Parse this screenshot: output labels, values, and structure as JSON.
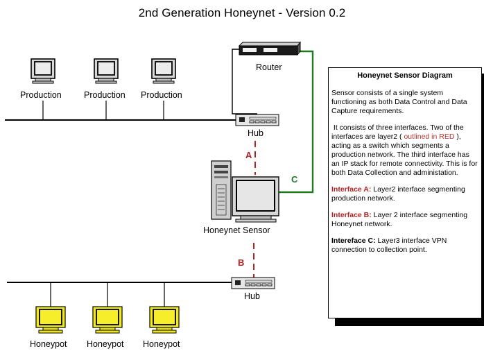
{
  "title": "2nd Generation Honeynet - Version 0.2",
  "colors": {
    "link_c": "#1e7b1e",
    "link_ab": "#b22222",
    "honeypot_screen": "#f2ea1c",
    "production_screen": "#e8e8e8"
  },
  "nodes": {
    "production": [
      "Production",
      "Production",
      "Production"
    ],
    "router": "Router",
    "hub_top": "Hub",
    "sensor": "Honeynet Sensor",
    "hub_bottom": "Hub",
    "honeypots": [
      "Honeypot",
      "Honeypot",
      "Honeypot"
    ]
  },
  "links": {
    "a": "A",
    "b": "B",
    "c": "C"
  },
  "panel": {
    "title": "Honeynet Sensor Diagram",
    "p1": "Sensor consists of a single system functioning as both Data Control and Data Capture requirements.",
    "p2_before": "It consists of three interfaces.  Two of the interfaces are layer2 ( ",
    "p2_red": "outlined in RED",
    "p2_after": " ), acting as a switch which segments a production network.  The third interface has an IP stack for remote connectivity.  This is for both Data Collection and administation.",
    "ia_label": "Interface A:",
    "ia_text": " Layer2 interface segmenting production network.",
    "ib_label": "Interface B:",
    "ib_text": " Layer 2 interface segmenting Honeynet network.",
    "ic_label": "Intereface C:",
    "ic_text": " Layer3 interface VPN connection to  collection point."
  }
}
